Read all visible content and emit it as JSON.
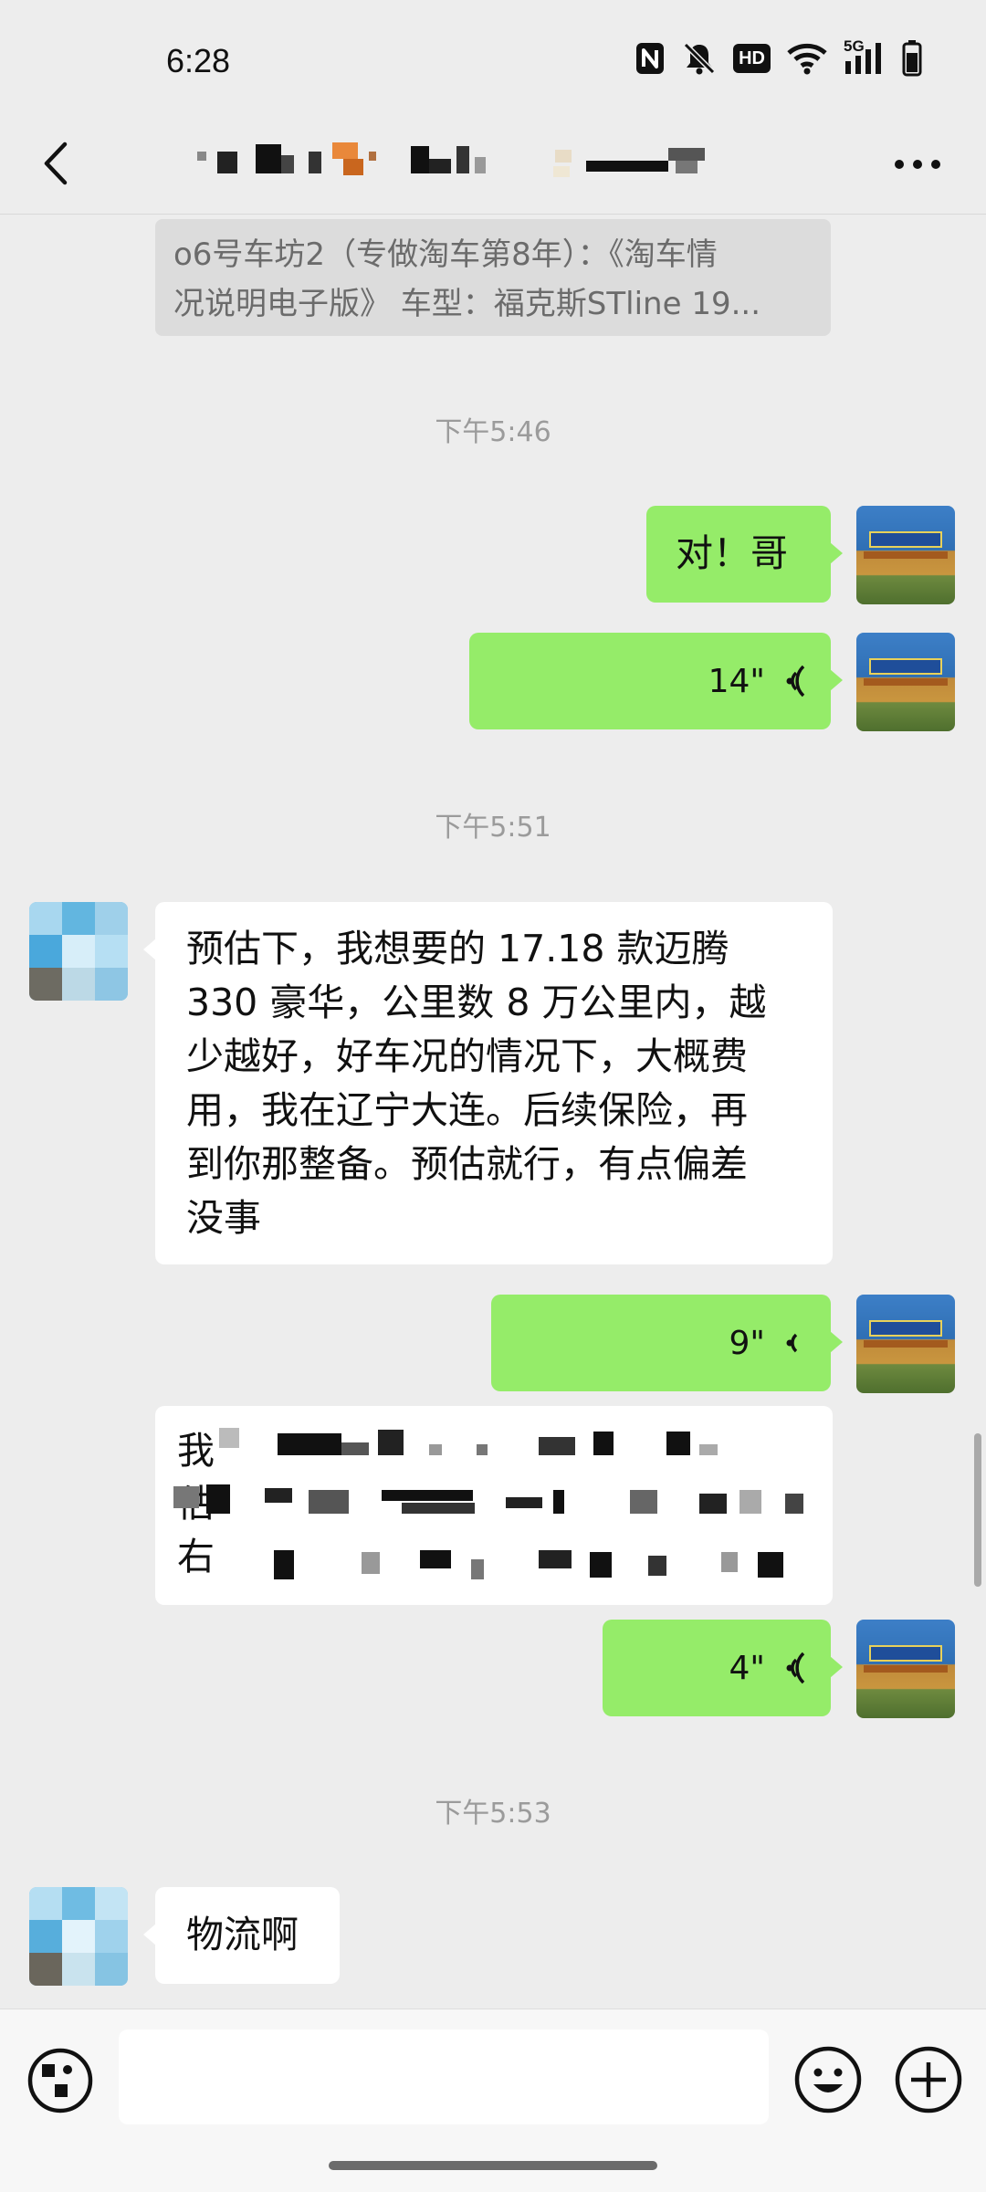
{
  "status_bar": {
    "time": "6:28",
    "icons": [
      "nfc-icon",
      "mute-icon",
      "hd-icon",
      "wifi-icon",
      "signal-5g-icon",
      "battery-icon"
    ],
    "hd_label": "HD",
    "network_label": "5G"
  },
  "nav": {
    "back_icon": "chevron-left-icon",
    "title_pixelated": true,
    "more_icon": "more-dots-icon"
  },
  "quote": {
    "line1": "o6号车坊2（专做淘车第8年）：《淘车情",
    "line2": "况说明电子版》  车型：福克斯STline 19..."
  },
  "messages": [
    {
      "type": "timestamp",
      "text": "下午5:46"
    },
    {
      "type": "text",
      "from": "self",
      "text": "对！哥"
    },
    {
      "type": "voice",
      "from": "self",
      "duration": "14\""
    },
    {
      "type": "timestamp",
      "text": "下午5:51"
    },
    {
      "type": "text",
      "from": "other",
      "lines": [
        "预估下，我想要的 17.18 款迈腾",
        "330 豪华，公里数 8 万公里内，越",
        "少越好，好车况的情况下，大概费",
        "用，我在辽宁大连。后续保险，再",
        "到你那整备。预估就行，有点偏差",
        "没事"
      ]
    },
    {
      "type": "voice",
      "from": "self",
      "duration": "9\""
    },
    {
      "type": "text",
      "from": "other",
      "pixelated": true,
      "visible_chars": [
        "我",
        "估",
        "右"
      ]
    },
    {
      "type": "voice",
      "from": "self",
      "duration": "4\""
    },
    {
      "type": "timestamp",
      "text": "下午5:53"
    },
    {
      "type": "text",
      "from": "other",
      "text": "物流啊"
    }
  ],
  "input_bar": {
    "placeholder": "",
    "value": "",
    "icons": [
      "voice-toggle-icon",
      "emoji-icon",
      "plus-icon"
    ]
  },
  "colors": {
    "background": "#ededed",
    "self_bubble": "#95ec69",
    "other_bubble": "#ffffff",
    "timestamp": "#9b9b9b"
  }
}
